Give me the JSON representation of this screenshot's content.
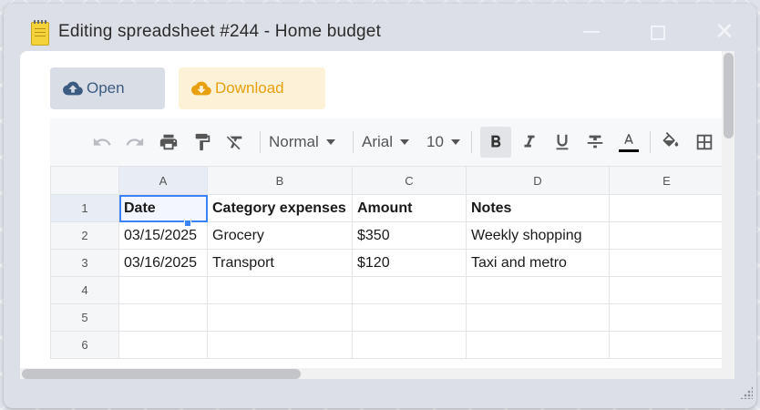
{
  "window": {
    "title": "Editing spreadsheet #244 - Home budget",
    "close_glyph": "✕"
  },
  "actions": {
    "open_label": "Open",
    "download_label": "Download"
  },
  "toolbar": {
    "style": "Normal",
    "font": "Arial",
    "size": "10",
    "icons": [
      "undo-icon",
      "redo-icon",
      "print-icon",
      "paint-format-icon",
      "clear-format-icon",
      "bold-icon",
      "italic-icon",
      "underline-icon",
      "strikethrough-icon",
      "text-color-icon",
      "fill-color-icon",
      "borders-icon"
    ],
    "text_color_bar": "#000000"
  },
  "sheet": {
    "columns": [
      "A",
      "B",
      "C",
      "D",
      "E"
    ],
    "rows": [
      {
        "num": "1",
        "cells": [
          "Date",
          "Category expenses",
          "Amount",
          "Notes",
          ""
        ]
      },
      {
        "num": "2",
        "cells": [
          "03/15/2025",
          "Grocery",
          "$350",
          "Weekly shopping",
          ""
        ]
      },
      {
        "num": "3",
        "cells": [
          "03/16/2025",
          "Transport",
          "$120",
          "Taxi and metro",
          ""
        ]
      },
      {
        "num": "4",
        "cells": [
          "",
          "",
          "",
          "",
          ""
        ]
      },
      {
        "num": "5",
        "cells": [
          "",
          "",
          "",
          "",
          ""
        ]
      },
      {
        "num": "6",
        "cells": [
          "",
          "",
          "",
          "",
          ""
        ]
      }
    ],
    "selected_cell": "A1"
  },
  "colors": {
    "open_text": "#3b5b80",
    "download_text": "#e8a00f",
    "selection": "#3b82f6"
  }
}
